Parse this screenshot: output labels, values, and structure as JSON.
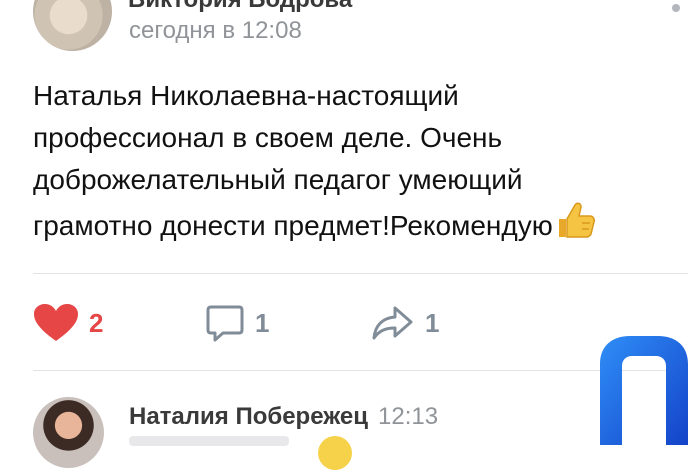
{
  "post": {
    "author": "Виктория Бодрова",
    "time": "сегодня в 12:08",
    "text_lines": [
      "Наталья Николаевна-настоящий",
      "профессионал в своем деле. Очень",
      "доброжелательный педагог умеющий",
      "грамотно донести предмет!Рекомендую"
    ],
    "emoji": "thumbs-up-icon"
  },
  "actions": {
    "likes": {
      "icon": "heart-icon",
      "count": "2",
      "color": "#e64646"
    },
    "comments": {
      "icon": "comment-icon",
      "count": "1",
      "color": "#818c99"
    },
    "shares": {
      "icon": "share-icon",
      "count": "1",
      "color": "#818c99"
    }
  },
  "next_comment": {
    "author": "Наталия Побережец",
    "time": "12:13"
  },
  "colors": {
    "accent_logo": "#1e6cf0",
    "muted": "#909499"
  }
}
